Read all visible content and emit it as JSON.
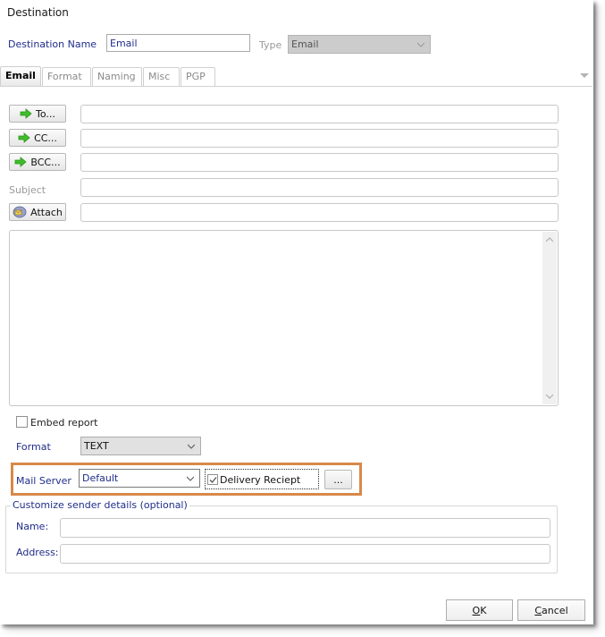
{
  "window": {
    "title": "Destination"
  },
  "header": {
    "destination_name_label": "Destination Name",
    "destination_name_value": "Email",
    "type_label": "Type",
    "type_value": "Email"
  },
  "tabs": [
    {
      "label": "Email",
      "active": true
    },
    {
      "label": "Format",
      "active": false
    },
    {
      "label": "Naming",
      "active": false
    },
    {
      "label": "Misc",
      "active": false
    },
    {
      "label": "PGP",
      "active": false
    }
  ],
  "email": {
    "to_button": "To...",
    "to_value": "",
    "cc_button": "CC...",
    "cc_value": "",
    "bcc_button": "BCC...",
    "bcc_value": "",
    "subject_label": "Subject",
    "subject_value": "",
    "attach_button": "Attach",
    "attach_value": "",
    "body_value": "",
    "embed_report_label": "Embed report",
    "embed_report_checked": false,
    "format_label": "Format",
    "format_value": "TEXT",
    "mail_server_label": "Mail Server",
    "mail_server_value": "Default",
    "delivery_receipt_label": "Delivery Reciept",
    "delivery_receipt_checked": true,
    "more_button": "..."
  },
  "sender": {
    "group_title": "Customize sender details (optional)",
    "name_label": "Name:",
    "name_value": "",
    "address_label": "Address:",
    "address_value": ""
  },
  "footer": {
    "ok_label": "OK",
    "ok_mnemonic": "O",
    "ok_rest": "K",
    "cancel_label": "Cancel",
    "cancel_mnemonic": "C",
    "cancel_rest": "ancel"
  },
  "colors": {
    "label_blue": "#1f2d8a",
    "highlight_orange": "#d8894a",
    "arrow_green": "#3fbf2a"
  }
}
